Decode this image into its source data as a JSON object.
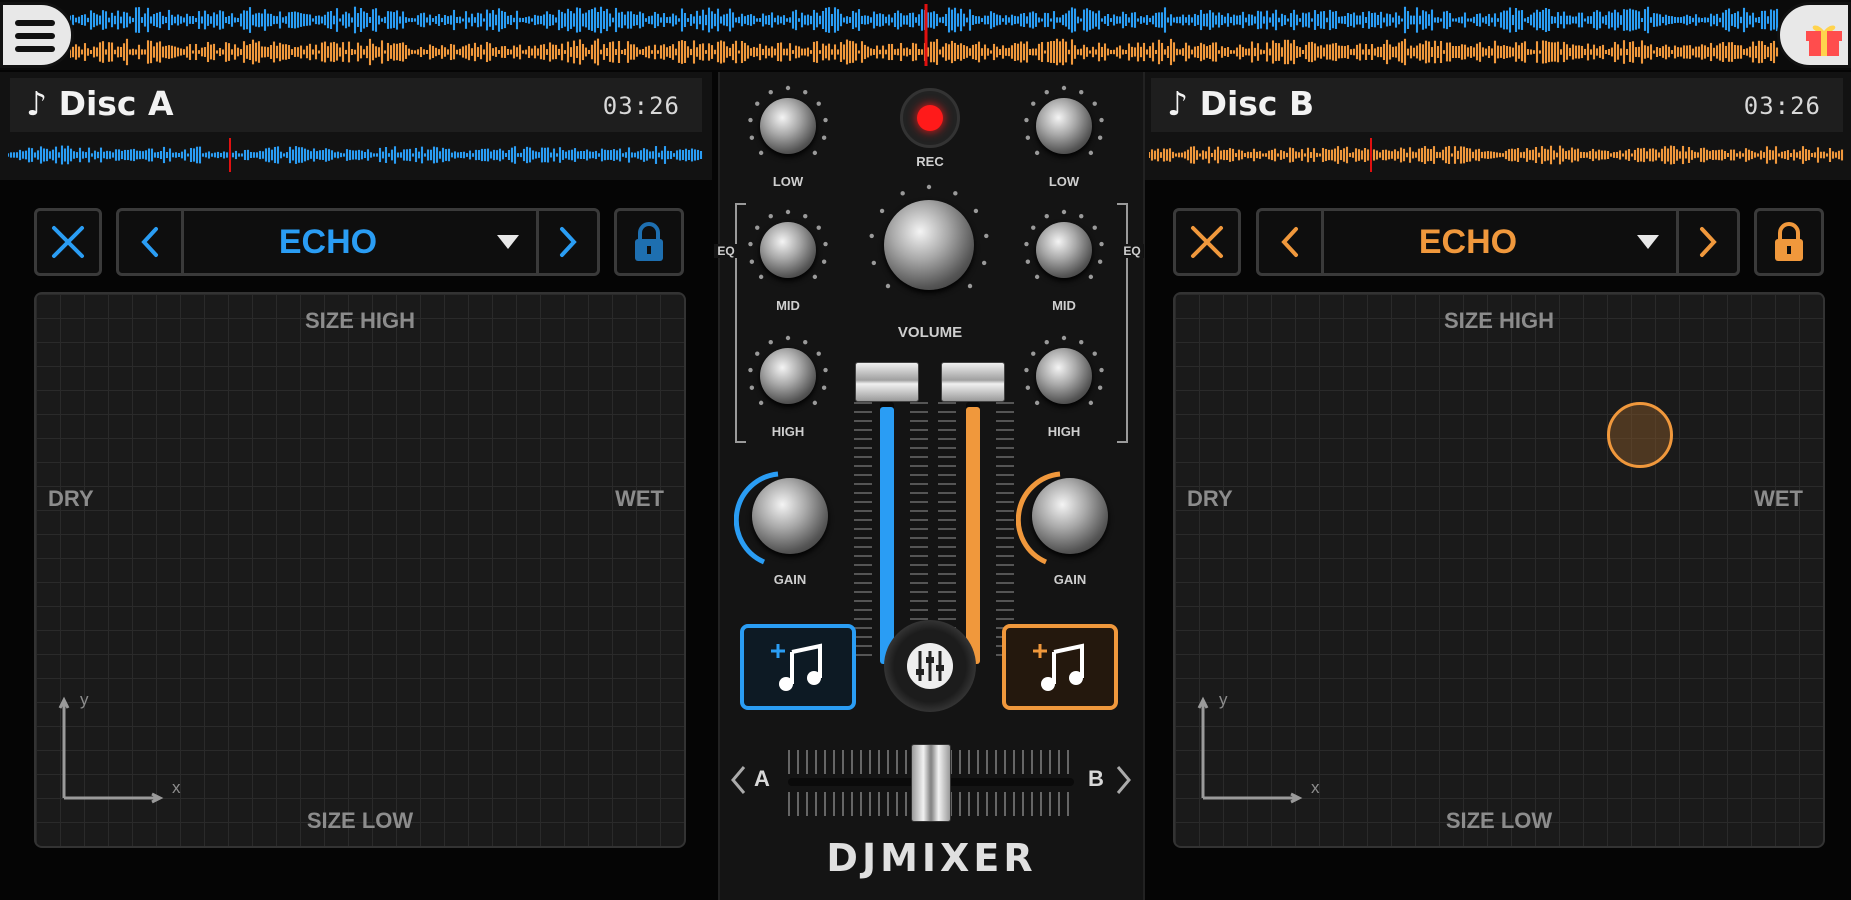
{
  "top": {
    "menu_icon": "hamburger-menu-icon",
    "gift_icon": "gift-icon"
  },
  "deck_a": {
    "title": "Disc A",
    "time": "03:26",
    "fx_name": "ECHO",
    "accent": "#2a9df4",
    "pad": {
      "top": "SIZE HIGH",
      "bottom": "SIZE LOW",
      "left": "DRY",
      "right": "WET",
      "axis_x": "x",
      "axis_y": "y"
    }
  },
  "deck_b": {
    "title": "Disc B",
    "time": "03:26",
    "fx_name": "ECHO",
    "accent": "#f0983c",
    "pad": {
      "top": "SIZE HIGH",
      "bottom": "SIZE LOW",
      "left": "DRY",
      "right": "WET",
      "axis_x": "x",
      "axis_y": "y"
    }
  },
  "mixer": {
    "rec": "REC",
    "eq": "EQ",
    "low": "LOW",
    "mid": "MID",
    "high": "HIGH",
    "volume": "VOLUME",
    "gain": "GAIN",
    "crossfader_a": "A",
    "crossfader_b": "B",
    "brand": "DJMIXER",
    "volume_a_level": 0.98,
    "volume_b_level": 0.98,
    "crossfader_position": 0.5
  },
  "colors": {
    "blue": "#2a9df4",
    "orange": "#f0983c",
    "rec_red": "#ff1a1a"
  }
}
